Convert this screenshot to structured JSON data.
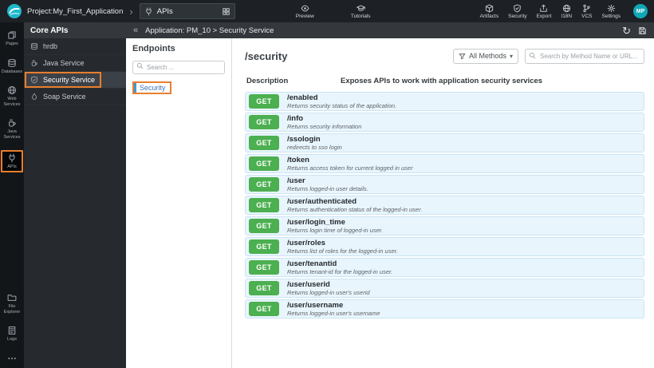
{
  "topbar": {
    "project": "Project:My_First_Application",
    "chevron": "›",
    "workspace_tab": {
      "label": "APIs"
    },
    "preview": "Preview",
    "tutorials": "Tutorials",
    "actions": [
      {
        "label": "Artifacts",
        "icon": "cube-icon"
      },
      {
        "label": "Security",
        "icon": "shield-icon"
      },
      {
        "label": "Export",
        "icon": "export-icon"
      },
      {
        "label": "I18N",
        "icon": "globe-icon"
      },
      {
        "label": "VCS",
        "icon": "branch-icon"
      },
      {
        "label": "Settings",
        "icon": "gear-icon"
      }
    ],
    "avatar": "MP"
  },
  "rail": {
    "top_items": [
      {
        "label": "Pages",
        "icon": "pages-icon"
      },
      {
        "label": "Databases",
        "icon": "database-icon"
      },
      {
        "label": "Web Services",
        "icon": "globe-icon"
      },
      {
        "label": "Java Services",
        "icon": "coffee-icon"
      },
      {
        "label": "APIs",
        "icon": "api-icon",
        "active": true
      }
    ],
    "bottom_items": [
      {
        "label": "File Explorer",
        "icon": "folder-icon"
      },
      {
        "label": "Logs",
        "icon": "logs-icon"
      },
      {
        "label": "",
        "icon": "dots-icon"
      }
    ]
  },
  "sidebar": {
    "title": "Core APIs",
    "items": [
      {
        "label": "hrdb",
        "icon": "database-icon"
      },
      {
        "label": "Java Service",
        "icon": "coffee-icon"
      },
      {
        "label": "Security Service",
        "icon": "shield-icon",
        "active": true
      },
      {
        "label": "Soap Service",
        "icon": "soap-icon"
      }
    ]
  },
  "appbar": {
    "collapse_glyph": "«",
    "breadcrumb": "Application: PM_10 > Security Service",
    "refresh_glyph": "↻"
  },
  "endpoints_panel": {
    "title": "Endpoints",
    "search_placeholder": "Search ...",
    "items": [
      {
        "label": "Security",
        "active": true
      }
    ]
  },
  "main": {
    "title": "/security",
    "methods_filter_label": "All Methods",
    "methods_caret": "▾",
    "search_placeholder": "Search by Method Name or URL...",
    "description_label": "Description",
    "description_text": "Exposes APIs to work with application security services",
    "endpoints": [
      {
        "method": "GET",
        "path": "/enabled",
        "desc": "Returns security status of the application."
      },
      {
        "method": "GET",
        "path": "/info",
        "desc": "Returns security information"
      },
      {
        "method": "GET",
        "path": "/ssologin",
        "desc": "redirects to sso login"
      },
      {
        "method": "GET",
        "path": "/token",
        "desc": "Returns access token for current logged in user"
      },
      {
        "method": "GET",
        "path": "/user",
        "desc": "Returns logged-in user details."
      },
      {
        "method": "GET",
        "path": "/user/authenticated",
        "desc": "Returns authentication status of the logged-in user."
      },
      {
        "method": "GET",
        "path": "/user/login_time",
        "desc": "Returns login time of logged-in user."
      },
      {
        "method": "GET",
        "path": "/user/roles",
        "desc": "Returns list of roles for the logged-in user."
      },
      {
        "method": "GET",
        "path": "/user/tenantid",
        "desc": "Returns tenant-id for the logged-in user."
      },
      {
        "method": "GET",
        "path": "/user/userid",
        "desc": "Returns logged-in user's userid"
      },
      {
        "method": "GET",
        "path": "/user/username",
        "desc": "Returns logged-in user's username"
      }
    ]
  },
  "colors": {
    "accent_orange": "#e87e2e",
    "get_green": "#4caf50",
    "row_blue_bg": "#e9f5fc",
    "brand_teal": "#1fb7cb",
    "topbar_bg": "#1d2126"
  }
}
